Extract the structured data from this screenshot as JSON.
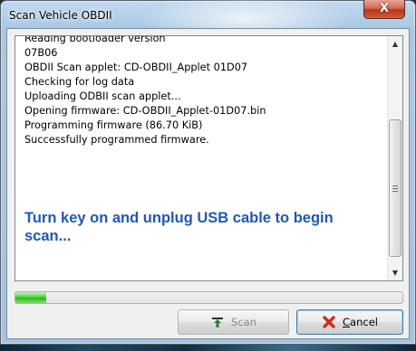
{
  "window": {
    "title": "Scan Vehicle OBDII",
    "close_label": "X"
  },
  "log": {
    "lines": [
      "Reading bootloader version",
      "07B06",
      "OBDII Scan applet: CD-OBDII_Applet 01D07",
      "Checking for log data",
      "Uploading ODBII scan applet...",
      "Opening firmware: CD-OBDII_Applet-01D07.bin",
      "Programming firmware (86.70 KiB)",
      "Successfully programmed firmware."
    ],
    "banner": "Turn key on and unplug USB cable to begin scan..."
  },
  "progress": {
    "value": 0.08,
    "color": "#3ccb27"
  },
  "buttons": {
    "scan_label": "Scan",
    "scan_icon": "upload-arrow-icon",
    "cancel_label_underlined": "C",
    "cancel_label_rest": "ancel",
    "cancel_icon": "red-x-icon"
  },
  "colors": {
    "banner_text": "#1e56c3",
    "cancel_x": "#d42a1a"
  }
}
